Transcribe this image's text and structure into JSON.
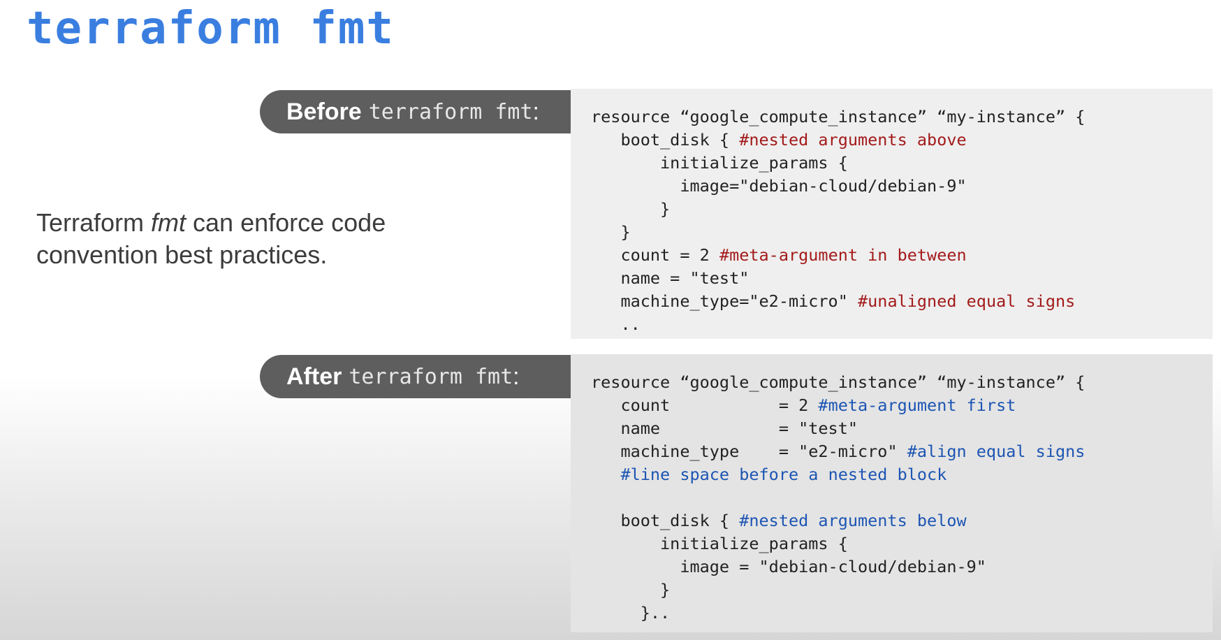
{
  "slide": {
    "title": "terraform fmt",
    "description": {
      "part1": "Terraform ",
      "italic": "fmt",
      "part2": " can enforce code convention best practices."
    }
  },
  "before": {
    "label": "Before",
    "command": "terraform fmt",
    "colon": ":",
    "lines": [
      {
        "code": "resource “google_compute_instance” “my-instance” {",
        "comment": ""
      },
      {
        "code": "   boot_disk { ",
        "comment": "#nested arguments above"
      },
      {
        "code": "       initialize_params {",
        "comment": ""
      },
      {
        "code": "         image=\"debian-cloud/debian-9\"",
        "comment": ""
      },
      {
        "code": "       }",
        "comment": ""
      },
      {
        "code": "   }",
        "comment": ""
      },
      {
        "code": "   count = 2 ",
        "comment": "#meta-argument in between"
      },
      {
        "code": "   name = \"test\"",
        "comment": ""
      },
      {
        "code": "   machine_type=\"e2-micro\" ",
        "comment": "#unaligned equal signs"
      },
      {
        "code": "   ..",
        "comment": ""
      }
    ]
  },
  "after": {
    "label": "After",
    "command": "terraform fmt",
    "colon": ":",
    "lines": [
      {
        "code": "resource “google_compute_instance” “my-instance” {",
        "comment": ""
      },
      {
        "code": "   count           = 2 ",
        "comment": "#meta-argument first"
      },
      {
        "code": "   name            = \"test\"",
        "comment": ""
      },
      {
        "code": "   machine_type    = \"e2-micro\" ",
        "comment": "#align equal signs"
      },
      {
        "code": "   ",
        "comment": "#line space before a nested block"
      },
      {
        "code": "",
        "comment": ""
      },
      {
        "code": "   boot_disk { ",
        "comment": "#nested arguments below"
      },
      {
        "code": "       initialize_params {",
        "comment": ""
      },
      {
        "code": "         image = \"debian-cloud/debian-9\"",
        "comment": ""
      },
      {
        "code": "       }",
        "comment": ""
      },
      {
        "code": "     }..",
        "comment": ""
      }
    ]
  },
  "colors": {
    "title": "#3a7ee0",
    "before_comment": "#a31b1b",
    "after_comment": "#1d55b3",
    "pill_background": "#5e5e5e"
  }
}
